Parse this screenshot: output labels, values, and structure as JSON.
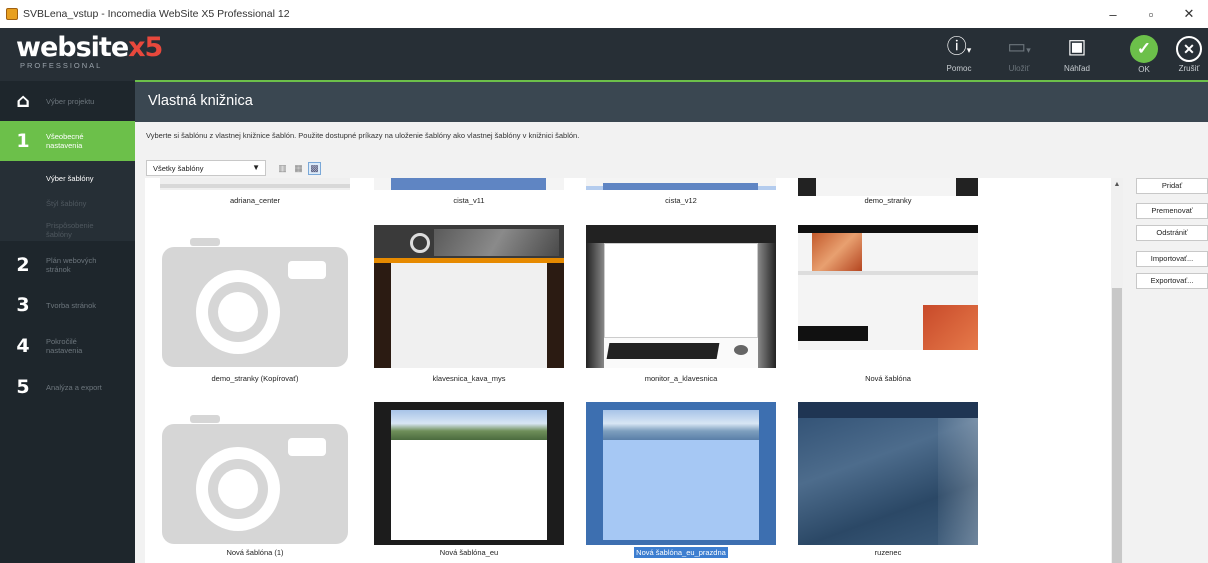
{
  "window": {
    "title": "SVBLena_vstup - Incomedia WebSite X5 Professional 12",
    "controls": {
      "minimize": "–",
      "maximize": "▫",
      "close": "✕"
    }
  },
  "logo": {
    "main": "website",
    "accent": "x5",
    "sub": "PROFESSIONAL"
  },
  "toolbar": {
    "help": {
      "label": "Pomoc",
      "icon": "help-icon"
    },
    "save": {
      "label": "Uložiť",
      "icon": "save-icon"
    },
    "preview": {
      "label": "Náhľad",
      "icon": "preview-icon"
    },
    "ok": {
      "label": "OK",
      "icon": "check-icon"
    },
    "cancel": {
      "label": "Zrušiť",
      "icon": "close-icon"
    }
  },
  "sidebar": {
    "home": {
      "label": "Výber projektu"
    },
    "steps": [
      {
        "num": "1",
        "label_line1": "Všeobecné",
        "label_line2": "nastavenia"
      },
      {
        "num": "2",
        "label_line1": "Plán webových",
        "label_line2": "stránok"
      },
      {
        "num": "3",
        "label_line1": "Tvorba stránok",
        "label_line2": ""
      },
      {
        "num": "4",
        "label_line1": "Pokročilé",
        "label_line2": "nastavenia"
      },
      {
        "num": "5",
        "label_line1": "Analýza a export",
        "label_line2": ""
      }
    ],
    "subitems": [
      {
        "line1": "Výber šablóny",
        "line2": ""
      },
      {
        "line1": "Štýl šablóny",
        "line2": ""
      },
      {
        "line1": "Prispôsobenie",
        "line2": "šablóny"
      }
    ]
  },
  "page": {
    "title": "Vlastná knižnica",
    "instructions": "Vyberte si šablónu z vlastnej knižnice šablón. Použite dostupné príkazy na uloženie šablóny ako vlastnej šablóny v knižnici šablón.",
    "filter": {
      "value": "Všetky šablóny",
      "arrow": "▼"
    }
  },
  "templates": {
    "row0": [
      "adriana_center",
      "cista_v11",
      "cista_v12",
      "demo_stranky"
    ],
    "row1": [
      "demo_stranky (Kopírovať)",
      "klavesnica_kava_mys",
      "monitor_a_klavesnica",
      "Nová šablóna"
    ],
    "row2": [
      "Nová šablóna (1)",
      "Nová šablóna_eu",
      "Nová šablóna_eu_prazdna",
      "ruzenec"
    ]
  },
  "actions": {
    "add": "Pridať",
    "rename": "Premenovať",
    "remove": "Odstrániť",
    "import": "Importovať...",
    "export": "Exportovať..."
  },
  "colors": {
    "accent_green": "#6cc04a",
    "toolbar_bg": "#272f36",
    "header_bg": "#3a4751",
    "selection_blue": "#3d7ed0"
  }
}
